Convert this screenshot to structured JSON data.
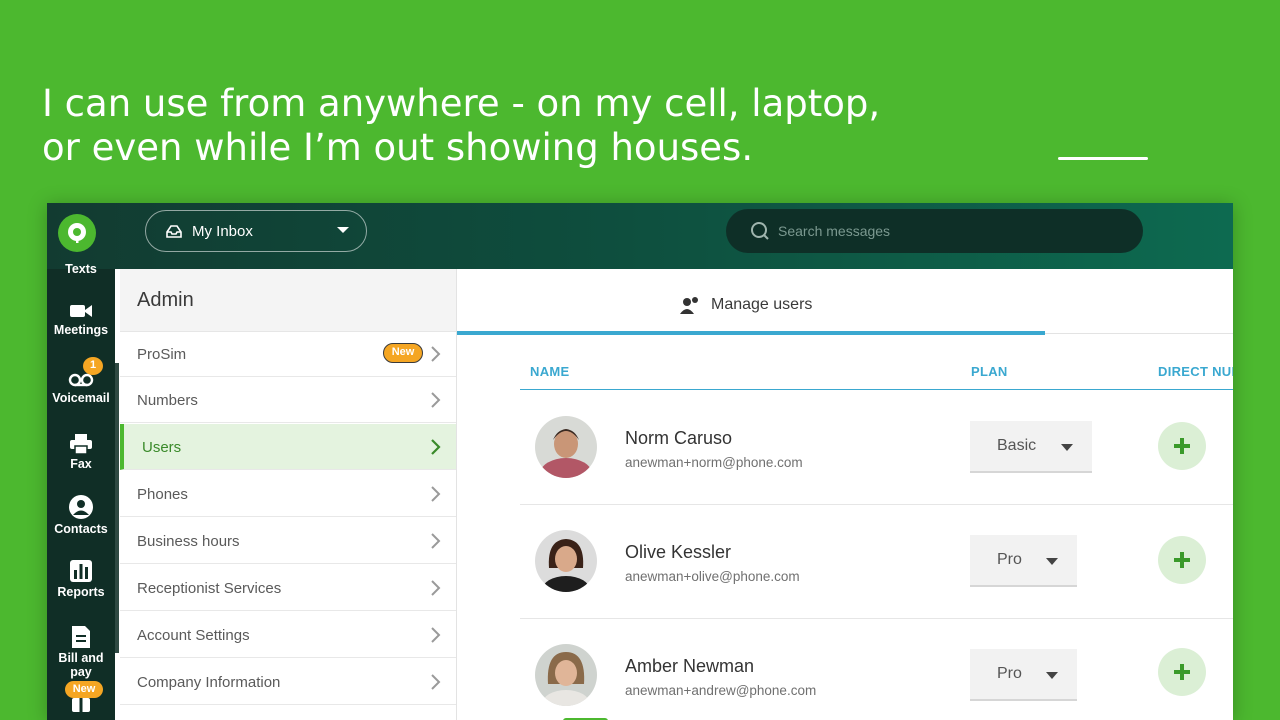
{
  "headline": {
    "line1": "I can use from anywhere - on my cell, laptop,",
    "line2": "or even while I’m out showing houses."
  },
  "topbar": {
    "inbox_label": "My Inbox",
    "search_placeholder": "Search messages"
  },
  "nav": {
    "items": [
      {
        "label": "Texts",
        "icon": "message-icon"
      },
      {
        "label": "Meetings",
        "icon": "video-camera-icon"
      },
      {
        "label": "Voicemail",
        "icon": "voicemail-icon",
        "badge": "1"
      },
      {
        "label": "Fax",
        "icon": "printer-icon"
      },
      {
        "label": "Contacts",
        "icon": "person-icon"
      },
      {
        "label": "Reports",
        "icon": "bar-chart-icon"
      },
      {
        "label": "Bill and pay",
        "icon": "invoice-icon"
      },
      {
        "label": "",
        "icon": "gift-icon",
        "badge": "New"
      }
    ]
  },
  "sidebar": {
    "title": "Admin",
    "items": [
      {
        "label": "ProSim",
        "badge": "New"
      },
      {
        "label": "Numbers"
      },
      {
        "label": "Users",
        "active": true
      },
      {
        "label": "Phones"
      },
      {
        "label": "Business hours"
      },
      {
        "label": "Receptionist Services"
      },
      {
        "label": "Account Settings"
      },
      {
        "label": "Company Information"
      }
    ]
  },
  "main": {
    "tab_label": "Manage users",
    "columns": {
      "name": "NAME",
      "plan": "PLAN",
      "direct": "DIRECT NUM"
    },
    "users": [
      {
        "name": "Norm Caruso",
        "email": "anewman+norm@phone.com",
        "plan": "Basic"
      },
      {
        "name": "Olive Kessler",
        "email": "anewman+olive@phone.com",
        "plan": "Pro"
      },
      {
        "name": "Amber Newman",
        "email": "anewman+andrew@phone.com",
        "plan": "Pro",
        "tag": "admin"
      }
    ]
  },
  "colors": {
    "brand_green": "#4cb82f",
    "accent_blue": "#3aa8d0",
    "badge_orange": "#f5a623",
    "nav_dark": "#102e26"
  }
}
